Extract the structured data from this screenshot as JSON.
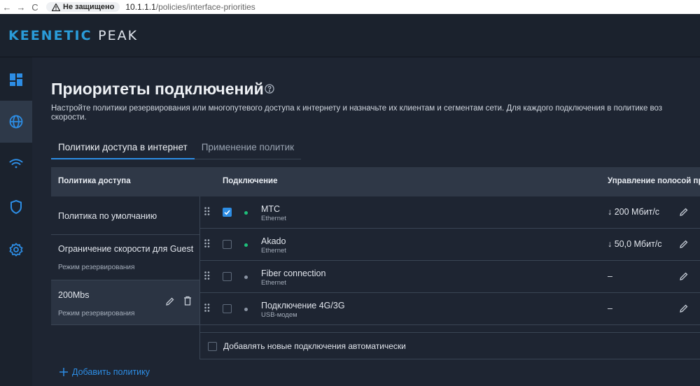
{
  "browser": {
    "back": "←",
    "forward": "→",
    "reload": "C",
    "security_label": "Не защищено",
    "url_host": "10.1.1.1",
    "url_path": "/policies/interface-priorities"
  },
  "header": {
    "logo_brand": "KEENETIC",
    "logo_model": "PEAK"
  },
  "sidebar": {
    "items": [
      {
        "icon": "dashboard-icon"
      },
      {
        "icon": "globe-icon",
        "active": true
      },
      {
        "icon": "wifi-icon"
      },
      {
        "icon": "shield-icon"
      },
      {
        "icon": "gear-icon"
      }
    ]
  },
  "page": {
    "title": "Приоритеты подключений",
    "subtitle_line1": "Настройте политики резервирования или многопутевого доступа к интернету и назначьте их клиентам и сегментам сети. Для каждого подключения в политике воз",
    "subtitle_line2": "скорости."
  },
  "tabs": [
    {
      "label": "Политики доступа в интернет",
      "active": true
    },
    {
      "label": "Применение политик",
      "active": false
    }
  ],
  "table": {
    "headers": {
      "policy": "Политика доступа",
      "connection": "Подключение",
      "bandwidth": "Управление полосой пр"
    },
    "policies": [
      {
        "name": "Политика по умолчанию",
        "mode": ""
      },
      {
        "name": "Ограничение скорости для Guest",
        "mode": "Режим резервирования"
      },
      {
        "name": "200Mbs",
        "mode": "Режим резервирования",
        "selected": true
      }
    ],
    "add_policy_label": "Добавить политику",
    "connections": [
      {
        "name": "МТС",
        "type": "Ethernet",
        "checked": true,
        "status_color": "#1ec07a",
        "speed": "↓ 200 Мбит/с"
      },
      {
        "name": "Akado",
        "type": "Ethernet",
        "checked": false,
        "status_color": "#1ec07a",
        "speed": "↓ 50,0 Мбит/с"
      },
      {
        "name": "Fiber connection",
        "type": "Ethernet",
        "checked": false,
        "status_color": "#8a94a3",
        "speed": "–"
      },
      {
        "name": "Подключение 4G/3G",
        "type": "USB-модем",
        "checked": false,
        "status_color": "#8a94a3",
        "speed": "–"
      }
    ],
    "auto_add_label": "Добавлять новые подключения автоматически"
  },
  "colors": {
    "accent": "#2d8de4",
    "online": "#1ec07a",
    "offline": "#8a94a3"
  }
}
